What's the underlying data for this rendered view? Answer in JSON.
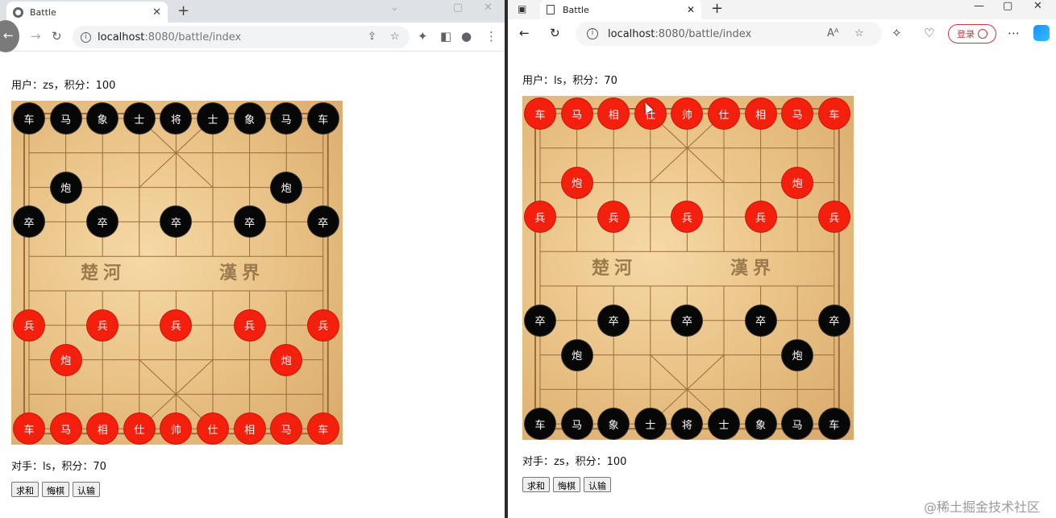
{
  "left": {
    "tab_title": "Battle",
    "url_host": "localhost",
    "url_rest": ":8080/battle/index",
    "user_line": "用户：zs，积分：100",
    "opponent_line": "对手：ls，积分：70",
    "buttons": [
      "求和",
      "悔棋",
      "认输"
    ]
  },
  "right": {
    "tab_title": "Battle",
    "url_host": "localhost",
    "url_rest": ":8080/battle/index",
    "login_label": "登录",
    "user_line": "用户：ls，积分：70",
    "opponent_line": "对手：zs，积分：100",
    "buttons": [
      "求和",
      "悔棋",
      "认输"
    ]
  },
  "board": {
    "river_left": "楚河",
    "river_right": "漢界"
  },
  "pieces_left": [
    {
      "col": 0,
      "row": 0,
      "color": "black",
      "label": "车"
    },
    {
      "col": 1,
      "row": 0,
      "color": "black",
      "label": "马"
    },
    {
      "col": 2,
      "row": 0,
      "color": "black",
      "label": "象"
    },
    {
      "col": 3,
      "row": 0,
      "color": "black",
      "label": "士"
    },
    {
      "col": 4,
      "row": 0,
      "color": "black",
      "label": "将"
    },
    {
      "col": 5,
      "row": 0,
      "color": "black",
      "label": "士"
    },
    {
      "col": 6,
      "row": 0,
      "color": "black",
      "label": "象"
    },
    {
      "col": 7,
      "row": 0,
      "color": "black",
      "label": "马"
    },
    {
      "col": 8,
      "row": 0,
      "color": "black",
      "label": "车"
    },
    {
      "col": 1,
      "row": 2,
      "color": "black",
      "label": "炮"
    },
    {
      "col": 7,
      "row": 2,
      "color": "black",
      "label": "炮"
    },
    {
      "col": 0,
      "row": 3,
      "color": "black",
      "label": "卒"
    },
    {
      "col": 2,
      "row": 3,
      "color": "black",
      "label": "卒"
    },
    {
      "col": 4,
      "row": 3,
      "color": "black",
      "label": "卒"
    },
    {
      "col": 6,
      "row": 3,
      "color": "black",
      "label": "卒"
    },
    {
      "col": 8,
      "row": 3,
      "color": "black",
      "label": "卒"
    },
    {
      "col": 0,
      "row": 6,
      "color": "red",
      "label": "兵"
    },
    {
      "col": 2,
      "row": 6,
      "color": "red",
      "label": "兵"
    },
    {
      "col": 4,
      "row": 6,
      "color": "red",
      "label": "兵"
    },
    {
      "col": 6,
      "row": 6,
      "color": "red",
      "label": "兵"
    },
    {
      "col": 8,
      "row": 6,
      "color": "red",
      "label": "兵"
    },
    {
      "col": 1,
      "row": 7,
      "color": "red",
      "label": "炮"
    },
    {
      "col": 7,
      "row": 7,
      "color": "red",
      "label": "炮"
    },
    {
      "col": 0,
      "row": 9,
      "color": "red",
      "label": "车"
    },
    {
      "col": 1,
      "row": 9,
      "color": "red",
      "label": "马"
    },
    {
      "col": 2,
      "row": 9,
      "color": "red",
      "label": "相"
    },
    {
      "col": 3,
      "row": 9,
      "color": "red",
      "label": "仕"
    },
    {
      "col": 4,
      "row": 9,
      "color": "red",
      "label": "帅"
    },
    {
      "col": 5,
      "row": 9,
      "color": "red",
      "label": "仕"
    },
    {
      "col": 6,
      "row": 9,
      "color": "red",
      "label": "相"
    },
    {
      "col": 7,
      "row": 9,
      "color": "red",
      "label": "马"
    },
    {
      "col": 8,
      "row": 9,
      "color": "red",
      "label": "车"
    }
  ],
  "pieces_right": [
    {
      "col": 0,
      "row": 0,
      "color": "red",
      "label": "车"
    },
    {
      "col": 1,
      "row": 0,
      "color": "red",
      "label": "马"
    },
    {
      "col": 2,
      "row": 0,
      "color": "red",
      "label": "相"
    },
    {
      "col": 3,
      "row": 0,
      "color": "red",
      "label": "仕"
    },
    {
      "col": 4,
      "row": 0,
      "color": "red",
      "label": "帅"
    },
    {
      "col": 5,
      "row": 0,
      "color": "red",
      "label": "仕"
    },
    {
      "col": 6,
      "row": 0,
      "color": "red",
      "label": "相"
    },
    {
      "col": 7,
      "row": 0,
      "color": "red",
      "label": "马"
    },
    {
      "col": 8,
      "row": 0,
      "color": "red",
      "label": "车"
    },
    {
      "col": 1,
      "row": 2,
      "color": "red",
      "label": "炮"
    },
    {
      "col": 7,
      "row": 2,
      "color": "red",
      "label": "炮"
    },
    {
      "col": 0,
      "row": 3,
      "color": "red",
      "label": "兵"
    },
    {
      "col": 2,
      "row": 3,
      "color": "red",
      "label": "兵"
    },
    {
      "col": 4,
      "row": 3,
      "color": "red",
      "label": "兵"
    },
    {
      "col": 6,
      "row": 3,
      "color": "red",
      "label": "兵"
    },
    {
      "col": 8,
      "row": 3,
      "color": "red",
      "label": "兵"
    },
    {
      "col": 0,
      "row": 6,
      "color": "black",
      "label": "卒"
    },
    {
      "col": 2,
      "row": 6,
      "color": "black",
      "label": "卒"
    },
    {
      "col": 4,
      "row": 6,
      "color": "black",
      "label": "卒"
    },
    {
      "col": 6,
      "row": 6,
      "color": "black",
      "label": "卒"
    },
    {
      "col": 8,
      "row": 6,
      "color": "black",
      "label": "卒"
    },
    {
      "col": 1,
      "row": 7,
      "color": "black",
      "label": "炮"
    },
    {
      "col": 7,
      "row": 7,
      "color": "black",
      "label": "炮"
    },
    {
      "col": 0,
      "row": 9,
      "color": "black",
      "label": "车"
    },
    {
      "col": 1,
      "row": 9,
      "color": "black",
      "label": "马"
    },
    {
      "col": 2,
      "row": 9,
      "color": "black",
      "label": "象"
    },
    {
      "col": 3,
      "row": 9,
      "color": "black",
      "label": "士"
    },
    {
      "col": 4,
      "row": 9,
      "color": "black",
      "label": "将"
    },
    {
      "col": 5,
      "row": 9,
      "color": "black",
      "label": "士"
    },
    {
      "col": 6,
      "row": 9,
      "color": "black",
      "label": "象"
    },
    {
      "col": 7,
      "row": 9,
      "color": "black",
      "label": "马"
    },
    {
      "col": 8,
      "row": 9,
      "color": "black",
      "label": "车"
    }
  ],
  "watermark": "@稀土掘金技术社区"
}
